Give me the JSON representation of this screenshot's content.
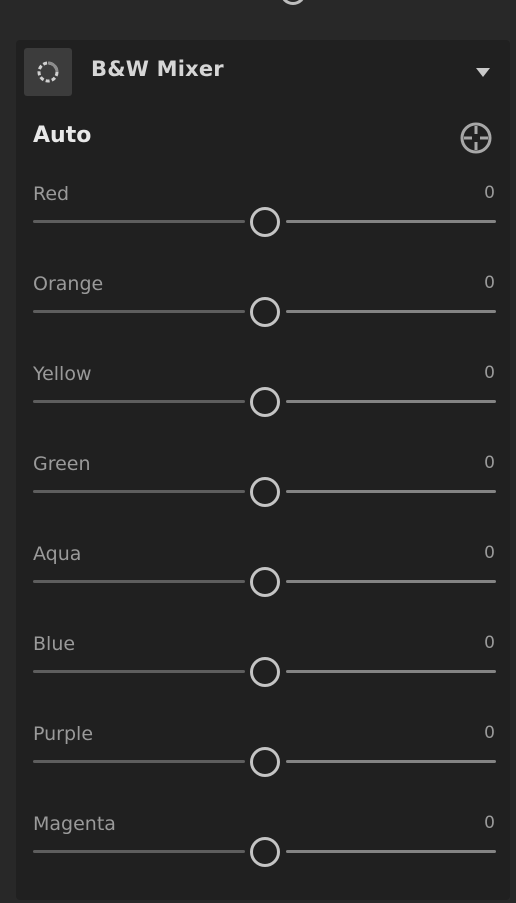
{
  "panel": {
    "title": "B&W Mixer",
    "icon": "bw-mixer-icon",
    "collapse_icon": "caret-down-icon"
  },
  "auto": {
    "label": "Auto",
    "target_icon": "target-adjustment-icon"
  },
  "sliders": [
    {
      "label": "Red",
      "value": "0",
      "level": 0.5
    },
    {
      "label": "Orange",
      "value": "0",
      "level": 0.5
    },
    {
      "label": "Yellow",
      "value": "0",
      "level": 0.5
    },
    {
      "label": "Green",
      "value": "0",
      "level": 0.5
    },
    {
      "label": "Aqua",
      "value": "0",
      "level": 0.5
    },
    {
      "label": "Blue",
      "value": "0",
      "level": 0.5
    },
    {
      "label": "Purple",
      "value": "0",
      "level": 0.5
    },
    {
      "label": "Magenta",
      "value": "0",
      "level": 0.5
    }
  ],
  "colors": {
    "panel_background": "#202020",
    "page_background": "#282828",
    "label_text": "#9a9a9a",
    "title_text": "#d6d6d6",
    "thumb_ring": "#c4c4c4"
  }
}
